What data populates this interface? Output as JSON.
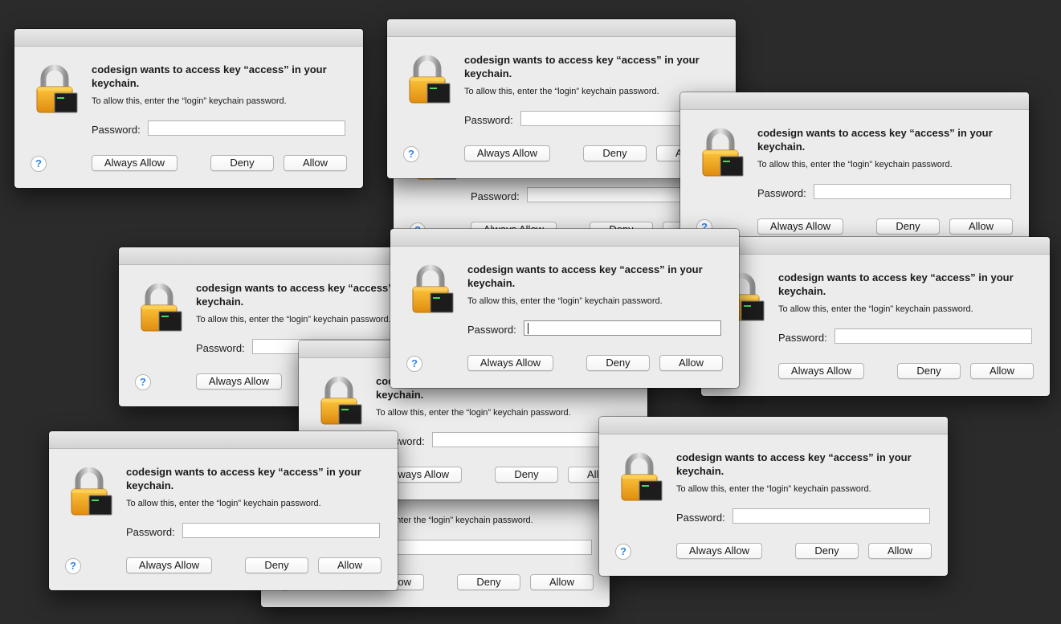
{
  "dialog": {
    "title": "codesign wants to access key “access” in your keychain.",
    "subtitle": "To allow this, enter the “login” keychain password.",
    "password_label": "Password:",
    "password_value": "",
    "help_label": "?",
    "always_allow_label": "Always Allow",
    "deny_label": "Deny",
    "allow_label": "Allow",
    "lock_icon": "lock-icon",
    "terminal_prompt": "exec"
  },
  "colors": {
    "background": "#2b2b2b",
    "dialog": "#ececec",
    "lock_gold": "#f0a81c",
    "help_blue": "#2e86e8"
  }
}
